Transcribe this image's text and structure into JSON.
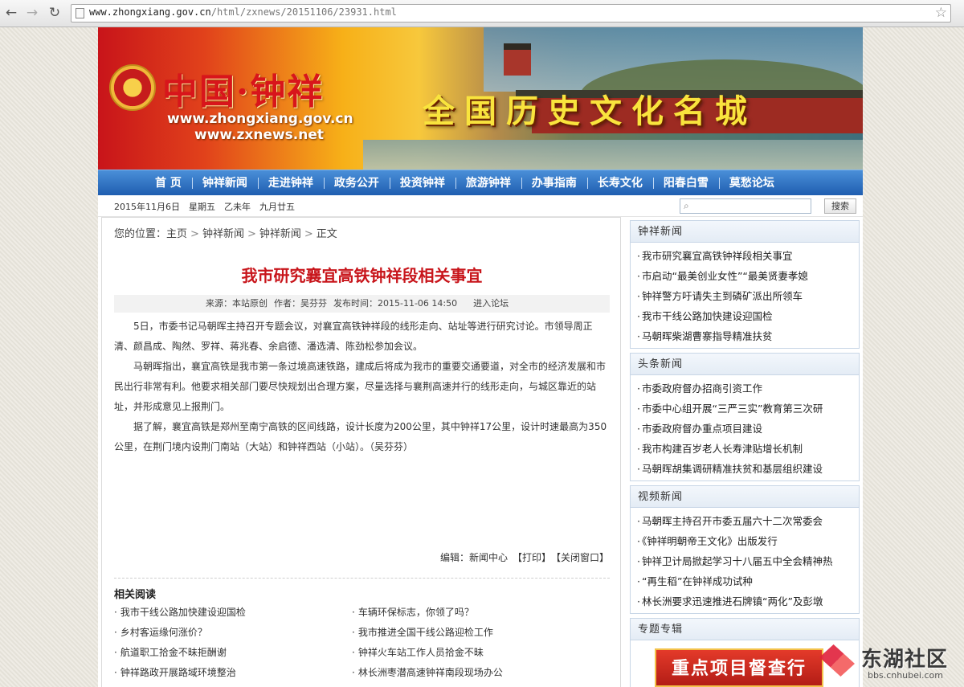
{
  "browser": {
    "url_host": "www.zhongxiang.gov.cn",
    "url_path": "/html/zxnews/20151106/23931.html",
    "back_icon": "arrow-left",
    "forward_icon": "arrow-right",
    "reload_icon": "reload",
    "bookmark_icon": "star"
  },
  "banner": {
    "brand": "中国·钟祥",
    "site1": "www.zhongxiang.gov.cn",
    "site2": "www.zxnews.net",
    "slogan": "全国历史文化名城"
  },
  "nav": {
    "items": [
      "首 页",
      "钟祥新闻",
      "走进钟祥",
      "政务公开",
      "投资钟祥",
      "旅游钟祥",
      "办事指南",
      "长寿文化",
      "阳春白雪",
      "莫愁论坛"
    ]
  },
  "datebar": {
    "date": "2015年11月6日　星期五　乙未年　九月廿五",
    "search_button": "搜索"
  },
  "article": {
    "breadcrumb": {
      "prefix": "您的位置：",
      "items": [
        "主页",
        "钟祥新闻",
        "钟祥新闻",
        "正文"
      ]
    },
    "title": "我市研究襄宜高铁钟祥段相关事宜",
    "meta": {
      "source": "来源：本站原创",
      "author": "作者：吴芬芬",
      "time": "发布时间：2015-11-06 14:50",
      "forum_link": "进入论坛"
    },
    "paragraphs": [
      "5日，市委书记马朝晖主持召开专题会议，对襄宜高铁钟祥段的线形走向、站址等进行研究讨论。市领导周正清、颜昌成、陶然、罗祥、蒋兆春、余启德、潘选清、陈劲松参加会议。",
      "马朝晖指出，襄宜高铁是我市第一条过境高速铁路，建成后将成为我市的重要交通要道，对全市的经济发展和市民出行非常有利。他要求相关部门要尽快规划出合理方案，尽量选择与襄荆高速并行的线形走向，与城区靠近的站址，并形成意见上报荆门。",
      "据了解，襄宜高铁是郑州至南宁高铁的区间线路，设计长度为200公里，其中钟祥17公里，设计时速最高为350公里，在荆门境内设荆门南站（大站）和钟祥西站（小站）。（吴芬芬）"
    ],
    "editor": "编辑：新闻中心",
    "print_link": "【打印】",
    "close_link": "【关闭窗口】",
    "related_title": "相关阅读",
    "related": [
      "我市干线公路加快建设迎国检",
      "车辆环保标志，你领了吗？",
      "乡村客运缘何涨价？",
      "我市推进全国干线公路迎检工作",
      "航道职工拾金不昧拒酬谢",
      "钟祥火车站工作人员拾金不昧",
      "钟祥路政开展路域环境整治",
      "林长洲枣潜高速钟祥南段现场办公"
    ]
  },
  "sidebar": {
    "boxes": [
      {
        "title": "钟祥新闻",
        "items": [
          "我市研究襄宜高铁钟祥段相关事宜",
          "市启动“最美创业女性”“最美贤妻孝媳",
          "钟祥警方吁请失主到磷矿派出所领车",
          "我市干线公路加快建设迎国检",
          "马朝晖柴湖曹寨指导精准扶贫"
        ]
      },
      {
        "title": "头条新闻",
        "items": [
          "市委政府督办招商引资工作",
          "市委中心组开展“三严三实”教育第三次研",
          "市委政府督办重点项目建设",
          "我市构建百岁老人长寿津贴增长机制",
          "马朝晖胡集调研精准扶贫和基层组织建设"
        ]
      },
      {
        "title": "视频新闻",
        "items": [
          "马朝晖主持召开市委五届六十二次常委会",
          "《钟祥明朝帝王文化》出版发行",
          "钟祥卫计局掀起学习十八届五中全会精神热",
          "“再生稻”在钟祥成功试种",
          "林长洲要求迅速推进石牌镇“两化”及彭墩"
        ]
      },
      {
        "title": "专题专辑",
        "promo": "重点项目督查行"
      }
    ]
  },
  "watermark": {
    "name": "东湖社区",
    "domain": "bbs.cnhubei.com"
  }
}
